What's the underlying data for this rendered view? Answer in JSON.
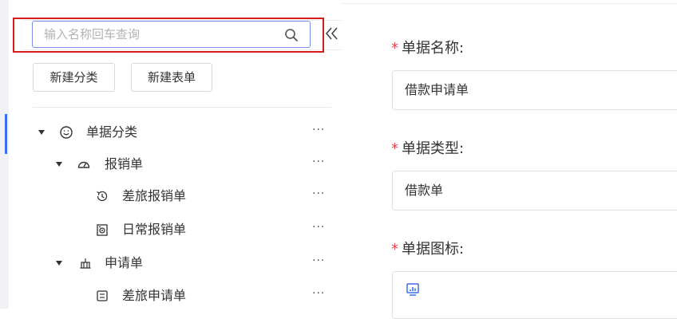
{
  "search": {
    "placeholder": "输入名称回车查询"
  },
  "buttons": {
    "new_category": "新建分类",
    "new_form": "新建表单"
  },
  "tree": [
    {
      "label": "单据分类",
      "icon": "smile-icon",
      "level": 0,
      "expanded": true
    },
    {
      "label": "报销单",
      "icon": "dashboard-icon",
      "level": 1,
      "expanded": true
    },
    {
      "label": "差旅报销单",
      "icon": "history-icon",
      "level": 2
    },
    {
      "label": "日常报销单",
      "icon": "camera-icon",
      "level": 2
    },
    {
      "label": "申请单",
      "icon": "bank-icon",
      "level": 1,
      "expanded": true
    },
    {
      "label": "差旅申请单",
      "icon": "save-icon",
      "level": 2
    }
  ],
  "more_label": "···",
  "form": {
    "name_label": "单据名称:",
    "name_value": "借款申请单",
    "type_label": "单据类型:",
    "type_value": "借款单",
    "icon_label": "单据图标:",
    "icon_value": "fund-icon"
  },
  "colors": {
    "accent": "#3d6ef0",
    "required": "#e8424a",
    "highlight": "#d51d1d"
  }
}
